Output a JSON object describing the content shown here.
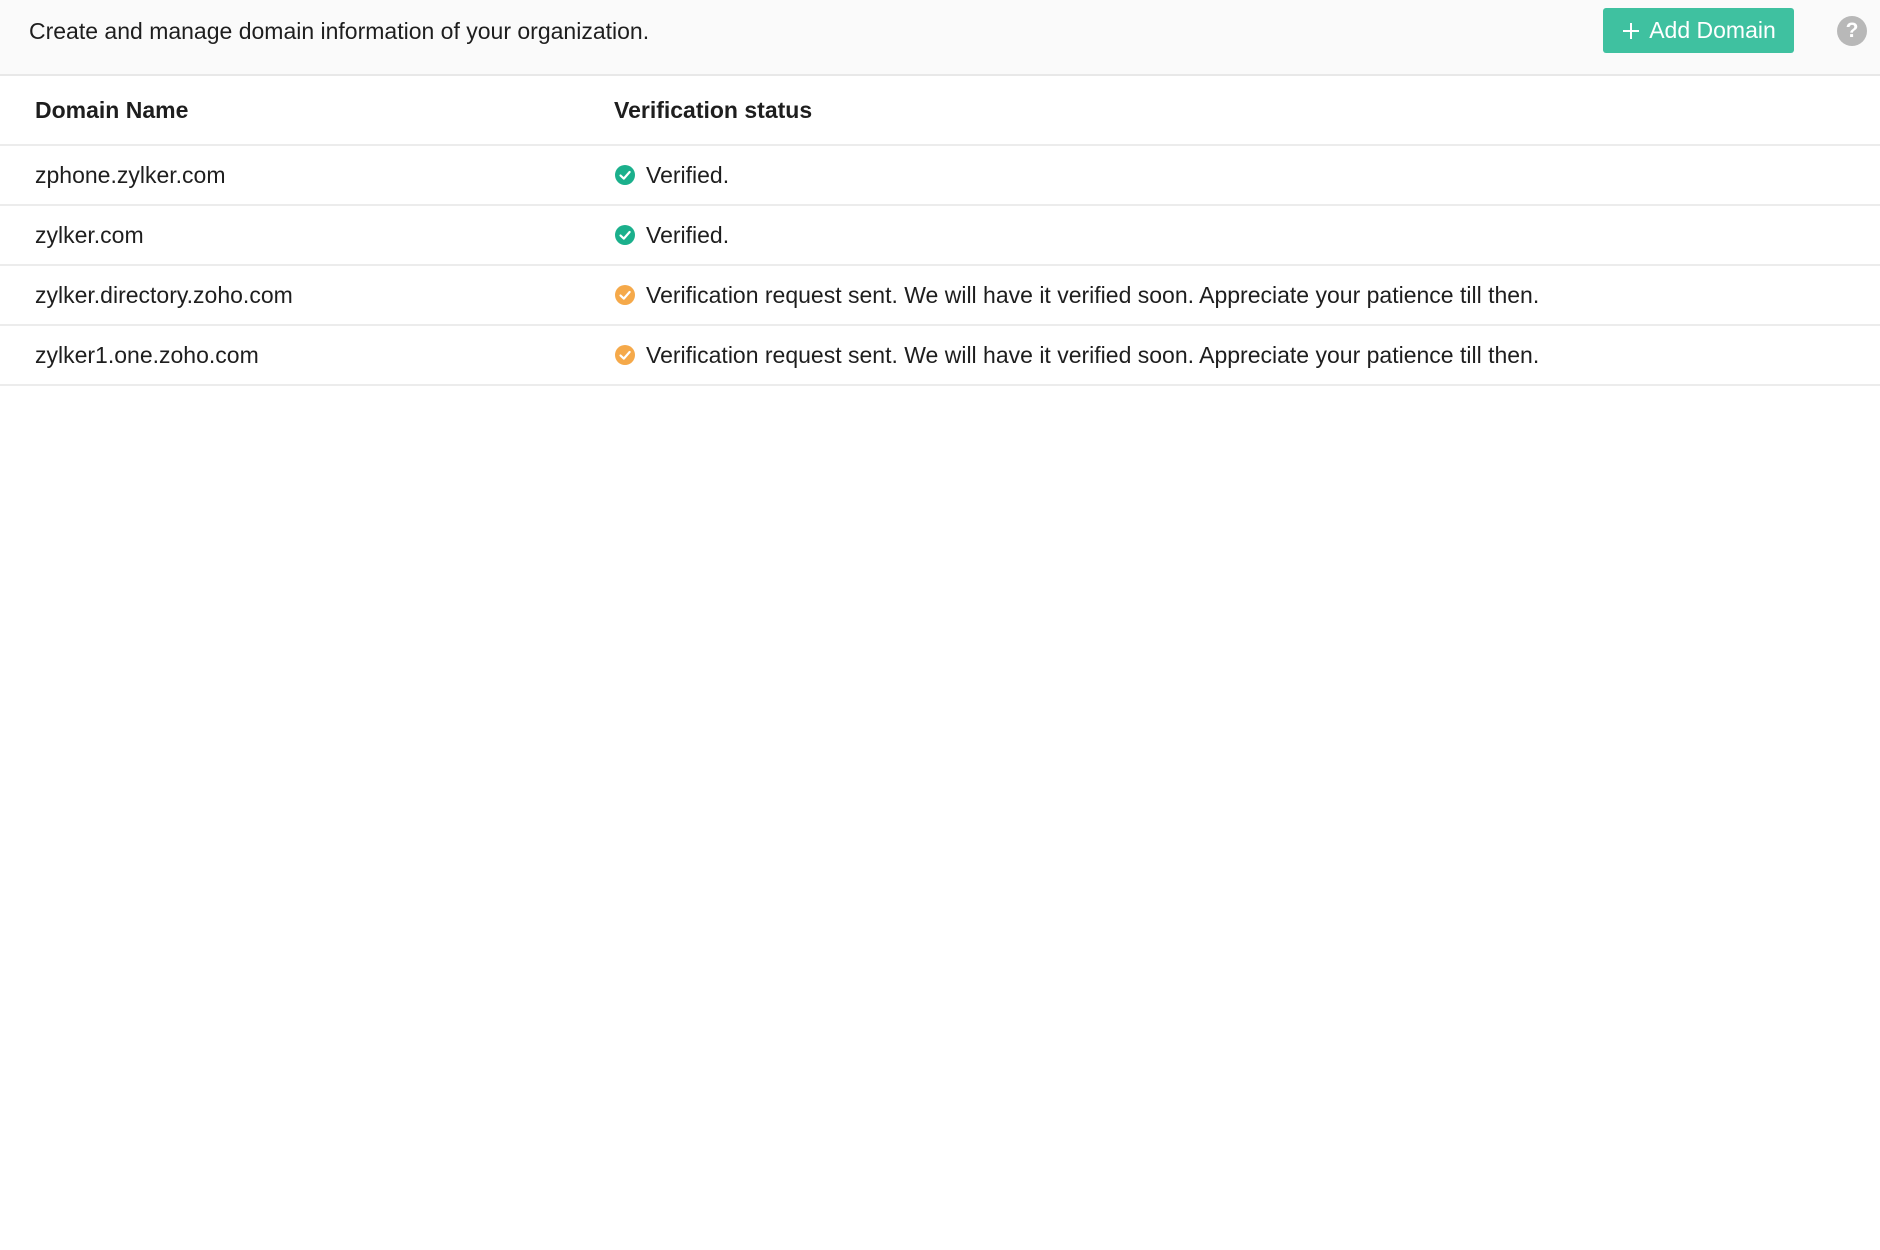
{
  "header": {
    "subtitle": "Create and manage domain information of your organization.",
    "add_button_label": "Add Domain",
    "help_symbol": "?"
  },
  "table": {
    "columns": [
      "Domain Name",
      "Verification status"
    ],
    "rows": [
      {
        "domain": "zphone.zylker.com",
        "status": "Verified.",
        "status_icon": "check-circle-icon",
        "status_color": "#1bb08c"
      },
      {
        "domain": "zylker.com",
        "status": "Verified.",
        "status_icon": "check-circle-icon",
        "status_color": "#1bb08c"
      },
      {
        "domain": "zylker.directory.zoho.com",
        "status": "Verification request sent. We will have it verified soon. Appreciate your patience till then.",
        "status_icon": "pending-check-circle-icon",
        "status_color": "#f5a94a"
      },
      {
        "domain": "zylker1.one.zoho.com",
        "status": "Verification request sent. We will have it verified soon. Appreciate your patience till then.",
        "status_icon": "pending-check-circle-icon",
        "status_color": "#f5a94a"
      }
    ]
  },
  "colors": {
    "accent": "#3fc1a0",
    "verified": "#1bb08c",
    "pending": "#f5a94a",
    "help_icon": "#b8b8b8"
  }
}
